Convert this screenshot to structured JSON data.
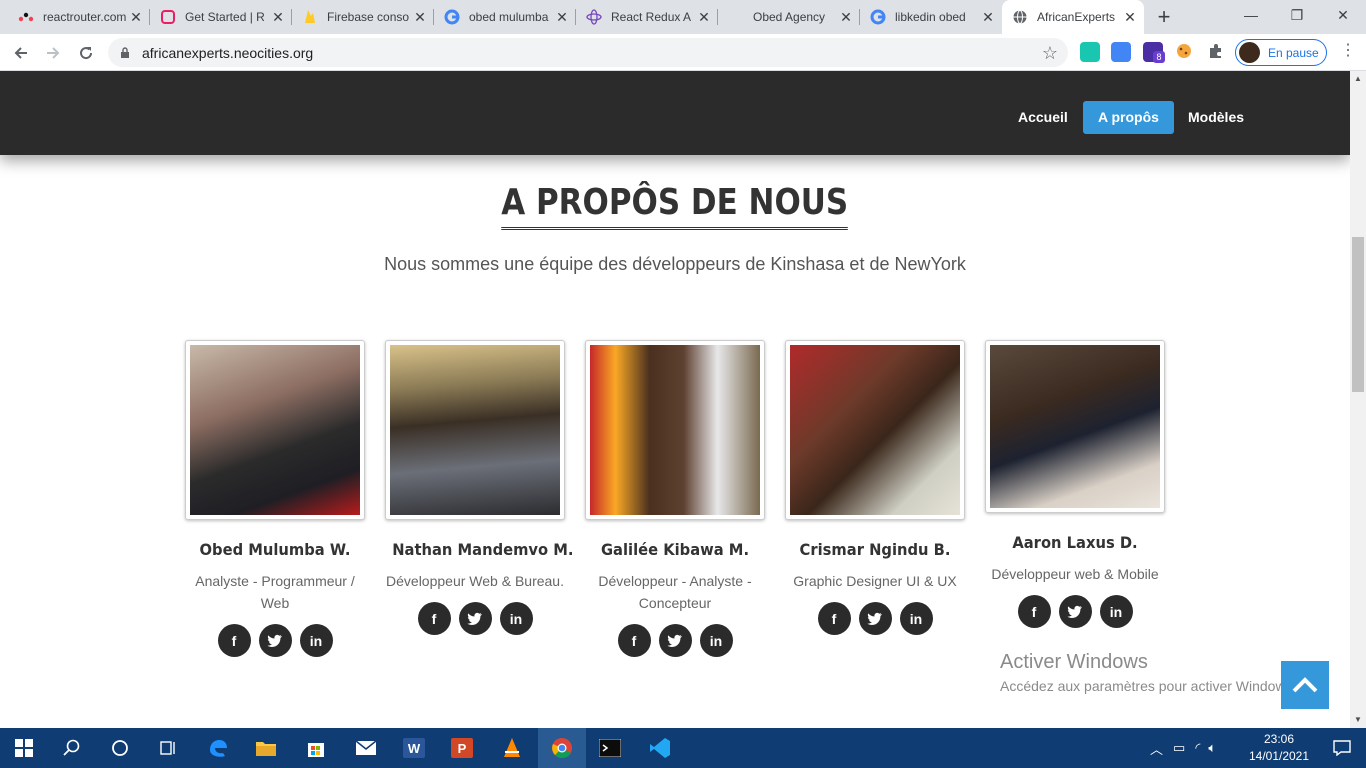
{
  "browser": {
    "tabs": [
      {
        "title": "reactrouter.com",
        "favicon": "reactrouter-icon",
        "color": "#f44250"
      },
      {
        "title": "Get Started | R",
        "favicon": "redux-toolkit-icon",
        "color": "#e91e63"
      },
      {
        "title": "Firebase conso",
        "favicon": "firebase-icon",
        "color": "#ffca28"
      },
      {
        "title": "obed mulumba",
        "favicon": "google-icon",
        "color": "#4285f4"
      },
      {
        "title": "React Redux A",
        "favicon": "react-redux-icon",
        "color": "#764abc"
      },
      {
        "title": "Obed Agency",
        "favicon": "blank-icon",
        "color": "#9e9e9e"
      },
      {
        "title": "libkedin obed",
        "favicon": "google-icon",
        "color": "#4285f4"
      },
      {
        "title": "AfricanExperts",
        "favicon": "globe-icon",
        "color": "#5f6368"
      }
    ],
    "url": "africanexperts.neocities.org",
    "profile_label": "En pause",
    "extension_badge": "8"
  },
  "site": {
    "nav": [
      {
        "label": "Accueil",
        "active": false
      },
      {
        "label": "A propôs",
        "active": true
      },
      {
        "label": "Modèles",
        "active": false
      }
    ],
    "title": "A PROPÔS DE NOUS",
    "subtitle": "Nous sommes une équipe des développeurs de Kinshasa et de NewYork",
    "members": [
      {
        "name": "Obed Mulumba W.",
        "role": "Analyste - Programmeur / Web"
      },
      {
        "name": "Nathan Mandemvo M.",
        "role": "Développeur Web & Bureau."
      },
      {
        "name": "Galilée Kibawa M.",
        "role": "Développeur - Analyste - Concepteur"
      },
      {
        "name": "Crismar Ngindu B.",
        "role": "Graphic Designer UI & UX"
      },
      {
        "name": "Aaron Laxus D.",
        "role": "Développeur web & Mobile"
      }
    ],
    "social_glyphs": {
      "facebook": "f",
      "twitter": "t",
      "linkedin": "in"
    }
  },
  "windows": {
    "activation_title": "Activer Windows",
    "activation_subtitle": "Accédez aux paramètres pour activer Windows.",
    "time": "23:06",
    "date": "14/01/2021"
  },
  "colors": {
    "accent": "#3498db",
    "navbar": "#2b2b2b",
    "taskbar": "#0f3c73"
  }
}
